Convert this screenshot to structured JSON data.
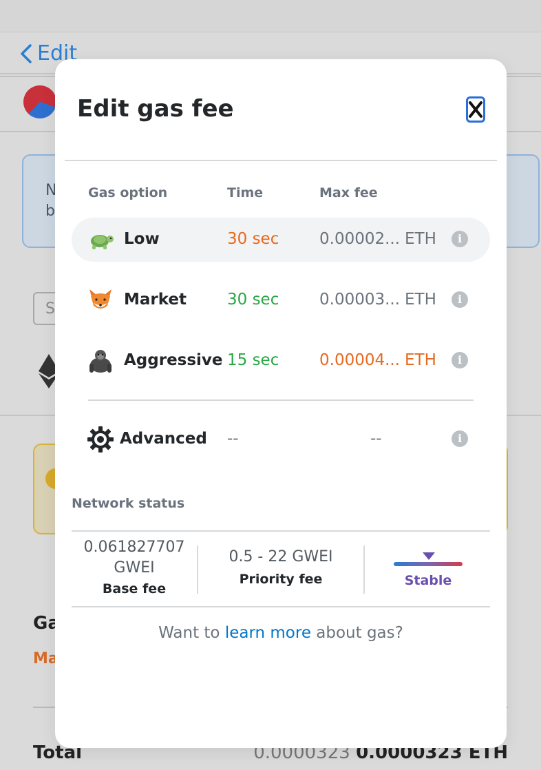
{
  "background": {
    "back_label": "Edit",
    "alert_line1": "N",
    "alert_line2": "b",
    "select_initial": "S",
    "gas_label": "Ga",
    "gas_sub": "Ma",
    "total_label": "Total",
    "total_fiat": "0.0000323",
    "total_eth": "0.0000323 ETH"
  },
  "modal": {
    "title": "Edit gas fee",
    "columns": {
      "option": "Gas option",
      "time": "Time",
      "max_fee": "Max fee"
    },
    "options": [
      {
        "name": "Low",
        "time": "30 sec",
        "fee": "0.00002...",
        "unit": "ETH",
        "icon": "turtle-icon",
        "selected": true
      },
      {
        "name": "Market",
        "time": "30 sec",
        "fee": "0.00003...",
        "unit": "ETH",
        "icon": "fox-icon",
        "selected": false
      },
      {
        "name": "Aggressive",
        "time": "15 sec",
        "fee": "0.00004...",
        "unit": "ETH",
        "icon": "gorilla-icon",
        "selected": false
      }
    ],
    "advanced": {
      "name": "Advanced",
      "time": "--",
      "fee": "--",
      "icon": "gear-icon"
    },
    "network_status": {
      "title": "Network status",
      "base_fee_value_1": "0.061827707",
      "base_fee_value_2": "GWEI",
      "base_fee_label": "Base fee",
      "priority_fee_value": "0.5 - 22 GWEI",
      "priority_fee_label": "Priority fee",
      "status_label": "Stable"
    },
    "footer": {
      "prefix": "Want to ",
      "link": "learn more",
      "suffix": " about gas?"
    }
  },
  "colors": {
    "accent_blue": "#0376c9",
    "warning_orange": "#e66a1f",
    "success_green": "#28a745",
    "stable_purple": "#6a4fb0"
  }
}
